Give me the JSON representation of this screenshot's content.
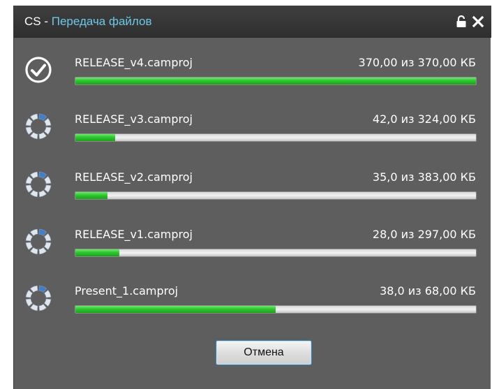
{
  "window": {
    "title_app": "CS",
    "title_separator": " - ",
    "title_name": "Передача файлов"
  },
  "files": [
    {
      "name": "RELEASE_v4.camproj",
      "size": "370,00 из 370,00 КБ",
      "progress": 1.0,
      "status": "complete",
      "icon": "checkmark-circle-icon"
    },
    {
      "name": "RELEASE_v3.camproj",
      "size": "42,0 из 324,00 КБ",
      "progress": 0.095,
      "status": "in-progress",
      "icon": "spinner-icon"
    },
    {
      "name": "RELEASE_v2.camproj",
      "size": "35,0 из 383,00 КБ",
      "progress": 0.08,
      "status": "in-progress",
      "icon": "spinner-icon"
    },
    {
      "name": "RELEASE_v1.camproj",
      "size": "28,0 из 297,00 КБ",
      "progress": 0.105,
      "status": "in-progress",
      "icon": "spinner-icon"
    },
    {
      "name": "Present_1.camproj",
      "size": "38,0 из 68,00 КБ",
      "progress": 0.5,
      "status": "in-progress",
      "icon": "spinner-icon"
    }
  ],
  "buttons": {
    "cancel_label": "Отмена"
  },
  "colors": {
    "accent_title": "#6cc8e8",
    "progress_green": "#2fc72f",
    "window_bg": "#5e5e5e"
  }
}
